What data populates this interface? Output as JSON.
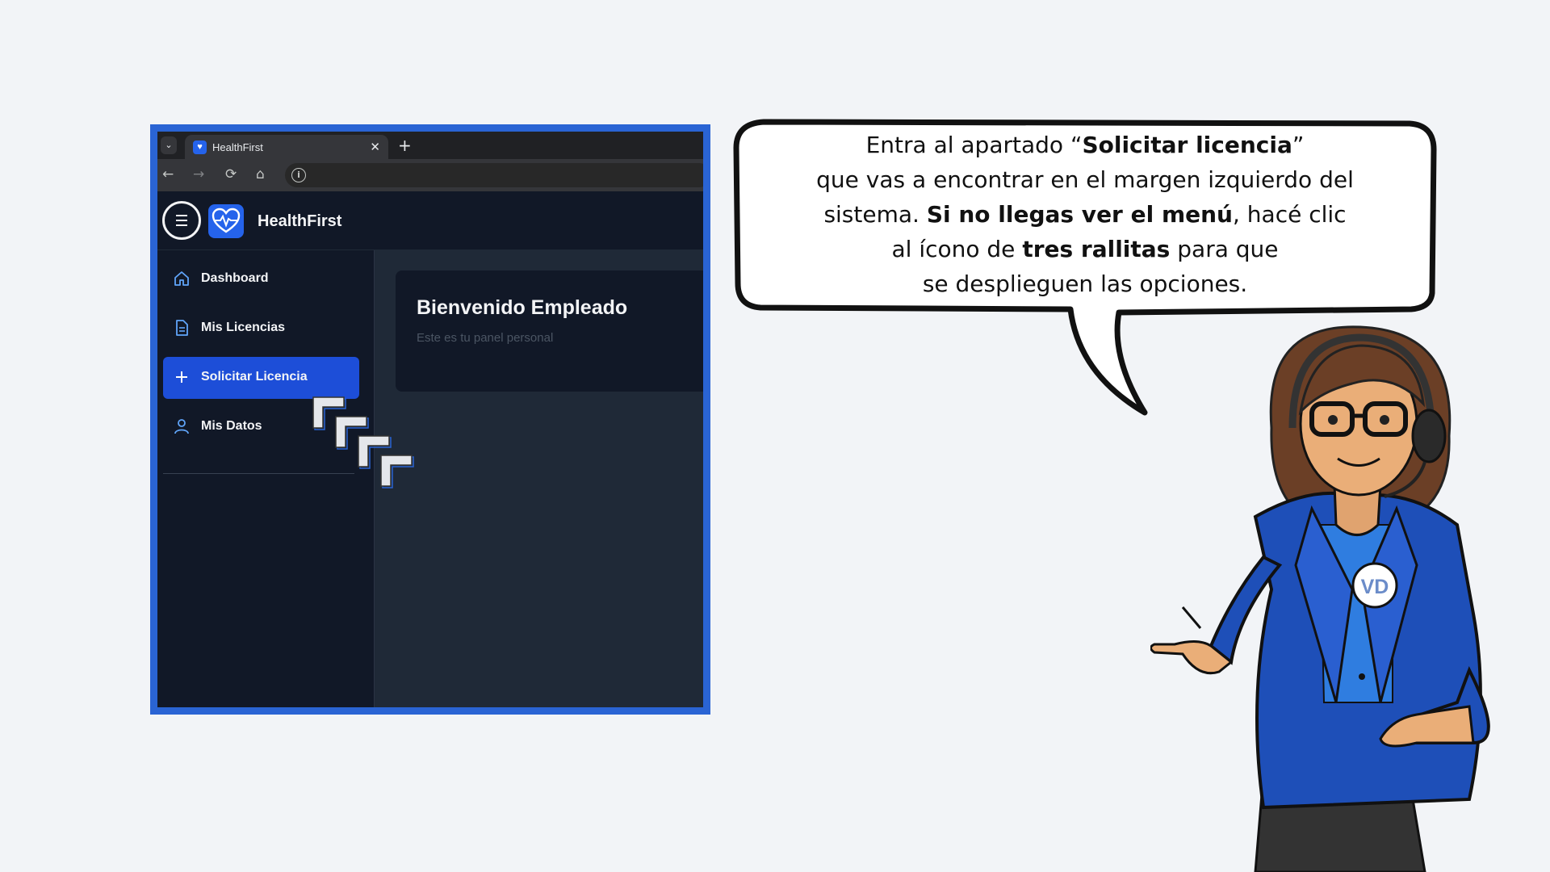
{
  "browser": {
    "tab_title": "HealthFirst",
    "tab_close": "✕",
    "new_tab": "+",
    "tab_list": "⌄"
  },
  "app": {
    "name": "HealthFirst",
    "sidebar": [
      {
        "label": "Dashboard",
        "icon": "home-icon"
      },
      {
        "label": "Mis Licencias",
        "icon": "document-icon"
      },
      {
        "label": "Solicitar Licencia",
        "icon": "plus-icon",
        "active": true
      },
      {
        "label": "Mis Datos",
        "icon": "user-icon"
      }
    ],
    "welcome": {
      "title": "Bienvenido Empleado",
      "subtitle": "Este es tu panel personal"
    }
  },
  "bubble": {
    "line1_pre": "Entra al apartado  “",
    "line1_bold": "Solicitar licencia",
    "line1_post": "”",
    "line2": "que vas a encontrar en el margen izquierdo del",
    "line3_pre": "sistema. ",
    "line3_bold": "Si no llegas ver el menú",
    "line3_post": ", hacé clic",
    "line4_pre": "al ícono de ",
    "line4_bold": "tres rallitas",
    "line4_post": "  para que",
    "line5": "se desplieguen las opciones."
  },
  "character": {
    "badge": "VD"
  },
  "colors": {
    "frame": "#2a64d4",
    "active_item": "#1d4ed8",
    "app_bg": "#111827",
    "content_bg": "#1f2937",
    "page_bg": "#f2f4f7"
  }
}
